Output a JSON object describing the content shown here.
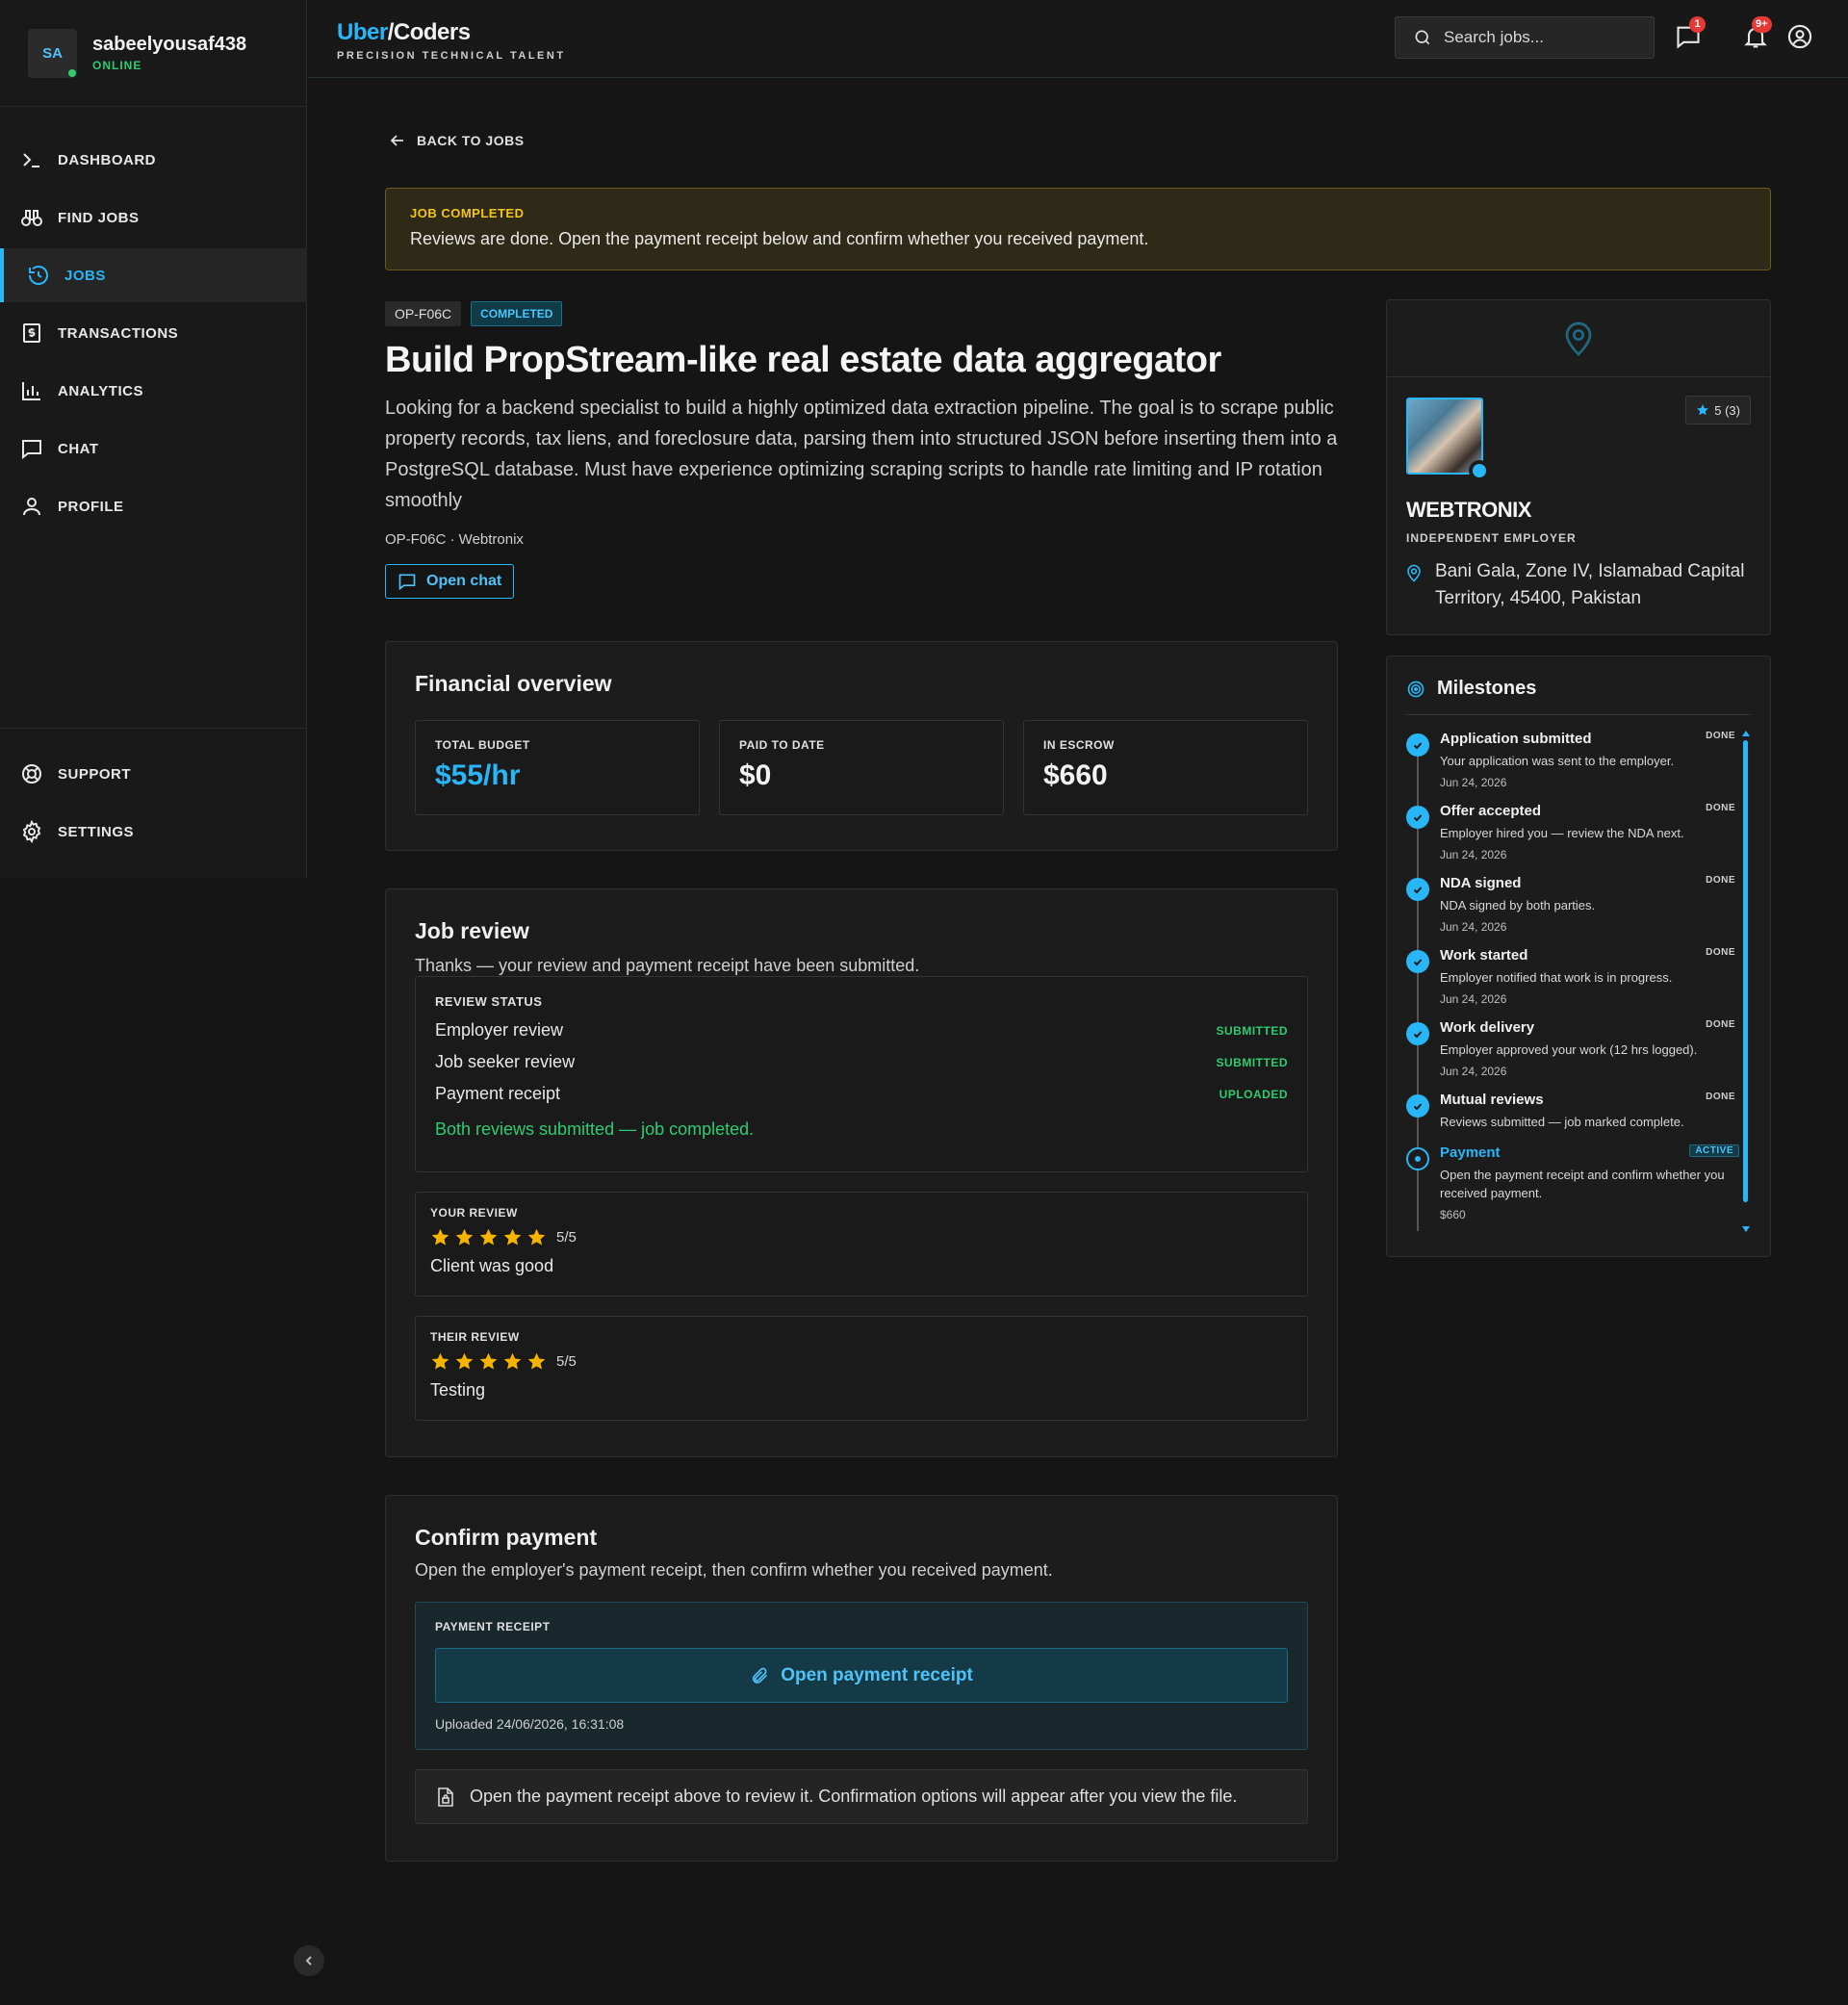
{
  "user": {
    "initials": "SA",
    "name": "sabeelyousaf438",
    "status": "ONLINE"
  },
  "nav": {
    "items": [
      {
        "label": "DASHBOARD",
        "icon": "terminal-icon"
      },
      {
        "label": "FIND JOBS",
        "icon": "binoculars-icon"
      },
      {
        "label": "JOBS",
        "icon": "history-icon",
        "active": true
      },
      {
        "label": "TRANSACTIONS",
        "icon": "receipt-dollar-icon"
      },
      {
        "label": "ANALYTICS",
        "icon": "bar-chart-icon"
      },
      {
        "label": "CHAT",
        "icon": "chat-icon"
      },
      {
        "label": "PROFILE",
        "icon": "user-icon"
      }
    ],
    "bottom": [
      {
        "label": "SUPPORT",
        "icon": "lifebuoy-icon"
      },
      {
        "label": "SETTINGS",
        "icon": "gear-icon"
      }
    ]
  },
  "topbar": {
    "logo_a": "Uber",
    "logo_b": "/Coders",
    "tagline": "PRECISION TECHNICAL TALENT",
    "search_placeholder": "Search jobs...",
    "chat_badge": "1",
    "notif_badge": "9+"
  },
  "back_label": "BACK TO JOBS",
  "banner": {
    "title": "JOB COMPLETED",
    "text": "Reviews are done. Open the payment receipt below and confirm whether you received payment."
  },
  "job": {
    "id": "OP-F06C",
    "status": "COMPLETED",
    "title": "Build PropStream-like real estate data aggregator",
    "description": "Looking for a backend specialist to build a highly optimized data extraction pipeline. The goal is to scrape public property records, tax liens, and foreclosure data, parsing them into structured JSON before inserting them into a PostgreSQL database. Must have experience optimizing scraping scripts to handle rate limiting and IP rotation smoothly",
    "meta": "OP-F06C · Webtronix",
    "open_chat": "Open chat"
  },
  "financial": {
    "title": "Financial overview",
    "boxes": [
      {
        "label": "TOTAL BUDGET",
        "value": "$55/hr",
        "accent": true
      },
      {
        "label": "PAID TO DATE",
        "value": "$0"
      },
      {
        "label": "IN ESCROW",
        "value": "$660"
      }
    ]
  },
  "review": {
    "title": "Job review",
    "subtitle": "Thanks — your review and payment receipt have been submitted.",
    "status_label": "REVIEW STATUS",
    "rows": [
      {
        "label": "Employer review",
        "state": "SUBMITTED"
      },
      {
        "label": "Job seeker review",
        "state": "SUBMITTED"
      },
      {
        "label": "Payment receipt",
        "state": "UPLOADED"
      }
    ],
    "done_text": "Both reviews submitted — job completed.",
    "yours": {
      "label": "YOUR REVIEW",
      "rating": 5,
      "score": "5/5",
      "text": "Client was good"
    },
    "theirs": {
      "label": "THEIR REVIEW",
      "rating": 5,
      "score": "5/5",
      "text": "Testing"
    }
  },
  "payment": {
    "title": "Confirm payment",
    "subtitle": "Open the employer's payment receipt, then confirm whether you received payment.",
    "receipt_label": "PAYMENT RECEIPT",
    "receipt_button": "Open payment receipt",
    "uploaded": "Uploaded 24/06/2026, 16:31:08",
    "note": "Open the payment receipt above to review it. Confirmation options will appear after you view the file."
  },
  "employer": {
    "rating": "5 (3)",
    "name": "WEBTRONIX",
    "role": "INDEPENDENT EMPLOYER",
    "location": "Bani Gala, Zone IV, Islamabad Capital Territory, 45400, Pakistan"
  },
  "milestones": {
    "title": "Milestones",
    "items": [
      {
        "title": "Application submitted",
        "state": "DONE",
        "desc": "Your application was sent to the employer.",
        "date": "Jun 24, 2026"
      },
      {
        "title": "Offer accepted",
        "state": "DONE",
        "desc": "Employer hired you — review the NDA next.",
        "date": "Jun 24, 2026"
      },
      {
        "title": "NDA signed",
        "state": "DONE",
        "desc": "NDA signed by both parties.",
        "date": "Jun 24, 2026"
      },
      {
        "title": "Work started",
        "state": "DONE",
        "desc": "Employer notified that work is in progress.",
        "date": "Jun 24, 2026"
      },
      {
        "title": "Work delivery",
        "state": "DONE",
        "desc": "Employer approved your work (12 hrs logged).",
        "date": "Jun 24, 2026"
      },
      {
        "title": "Mutual reviews",
        "state": "DONE",
        "desc": "Reviews submitted — job marked complete.",
        "date": ""
      },
      {
        "title": "Payment",
        "state": "ACTIVE",
        "desc": "Open the payment receipt and confirm whether you received payment.",
        "date": "$660"
      }
    ]
  },
  "colors": {
    "accent": "#29b6f6",
    "success": "#2ecc71",
    "warning": "#f5c518",
    "star": "#f5b400"
  }
}
